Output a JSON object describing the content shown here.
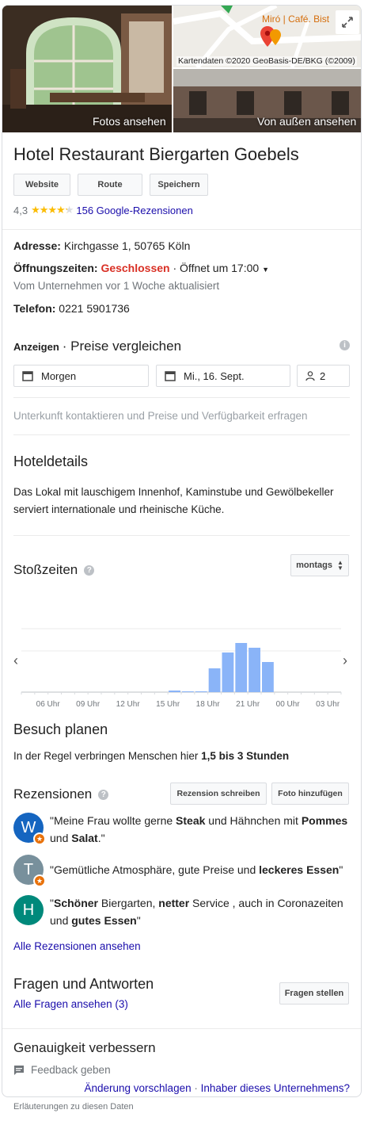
{
  "hero": {
    "photos_label": "Fotos ansehen",
    "exterior_label": "Von außen ansehen",
    "map_label": "Miró | Café. Bist",
    "map_copyright": "Kartendaten ©2020 GeoBasis-DE/BKG (©2009)"
  },
  "business": {
    "name": "Hotel Restaurant Biergarten Goebels",
    "buttons": [
      "Website",
      "Route",
      "Speichern"
    ],
    "rating": "4,3",
    "stars": 4.3,
    "reviews_link": "156 Google-Rezensionen"
  },
  "details": {
    "address_label": "Adresse:",
    "address": "Kirchgasse 1, 50765 Köln",
    "hours_label": "Öffnungszeiten:",
    "hours_status": "Geschlossen",
    "hours_next": "· Öffnet um 17:00",
    "updated": "Vom Unternehmen vor 1 Woche aktualisiert",
    "phone_label": "Telefon:",
    "phone": "0221 5901736"
  },
  "prices": {
    "ads_label": "Anzeigen",
    "title": "· Preise vergleichen",
    "checkin": "Morgen",
    "checkout": "Mi., 16. Sept.",
    "guests": "2",
    "contact_note": "Unterkunft kontaktieren und Preise und Verfügbarkeit erfragen"
  },
  "hotel_details": {
    "title": "Hoteldetails",
    "description": "Das Lokal mit lauschigem Innenhof, Kaminstube und Gewölbekeller serviert internationale und rheinische Küche."
  },
  "popular_times": {
    "title": "Stoßzeiten",
    "day_select": "montags",
    "chart_data": {
      "type": "bar",
      "categories": [
        "06 Uhr",
        "09 Uhr",
        "12 Uhr",
        "15 Uhr",
        "18 Uhr",
        "21 Uhr",
        "00 Uhr",
        "03 Uhr"
      ],
      "hours": [
        15,
        16,
        17,
        18,
        19,
        20,
        21,
        22
      ],
      "values": [
        2,
        0,
        0,
        30,
        50,
        62,
        56,
        38
      ],
      "ylim": [
        0,
        100
      ],
      "start_hour": 4,
      "end_hour": 28
    }
  },
  "visit": {
    "title": "Besuch planen",
    "text_prefix": "In der Regel verbringen Menschen hier ",
    "text_bold": "1,5 bis 3 Stunden"
  },
  "reviews": {
    "title": "Rezensionen",
    "write_button": "Rezension schreiben",
    "photo_button": "Foto hinzufügen",
    "items": [
      {
        "initial": "W",
        "color": "#1565c0",
        "badge": true,
        "parts": [
          "\"Meine Frau wollte gerne ",
          "Steak",
          " und Hähnchen mit ",
          "Pommes",
          " und ",
          "Salat",
          ".\""
        ]
      },
      {
        "initial": "T",
        "color": "#78909c",
        "badge": true,
        "parts": [
          "\"Gemütliche Atmosphäre, gute Preise und ",
          "leckeres Essen",
          "\""
        ]
      },
      {
        "initial": "H",
        "color": "#00897b",
        "badge": false,
        "parts": [
          "\"",
          "Schöner",
          " Biergarten, ",
          "netter",
          " Service , auch in Coronazeiten und ",
          "gutes Essen",
          "\""
        ]
      }
    ],
    "all_link": "Alle Rezensionen ansehen"
  },
  "qa": {
    "title": "Fragen und Antworten",
    "all_link": "Alle Fragen ansehen (3)",
    "ask_button": "Fragen stellen"
  },
  "accuracy": {
    "title": "Genauigkeit verbessern",
    "feedback": "Feedback geben",
    "suggest_link": "Änderung vorschlagen",
    "owner_link": "Inhaber dieses Unternehmens?"
  },
  "footer": {
    "note": "Erläuterungen zu diesen Daten"
  },
  "colors": {
    "bar": "#8ab4f8",
    "link": "#1a0dab",
    "closed": "#d93025",
    "star": "#fbbc04"
  }
}
